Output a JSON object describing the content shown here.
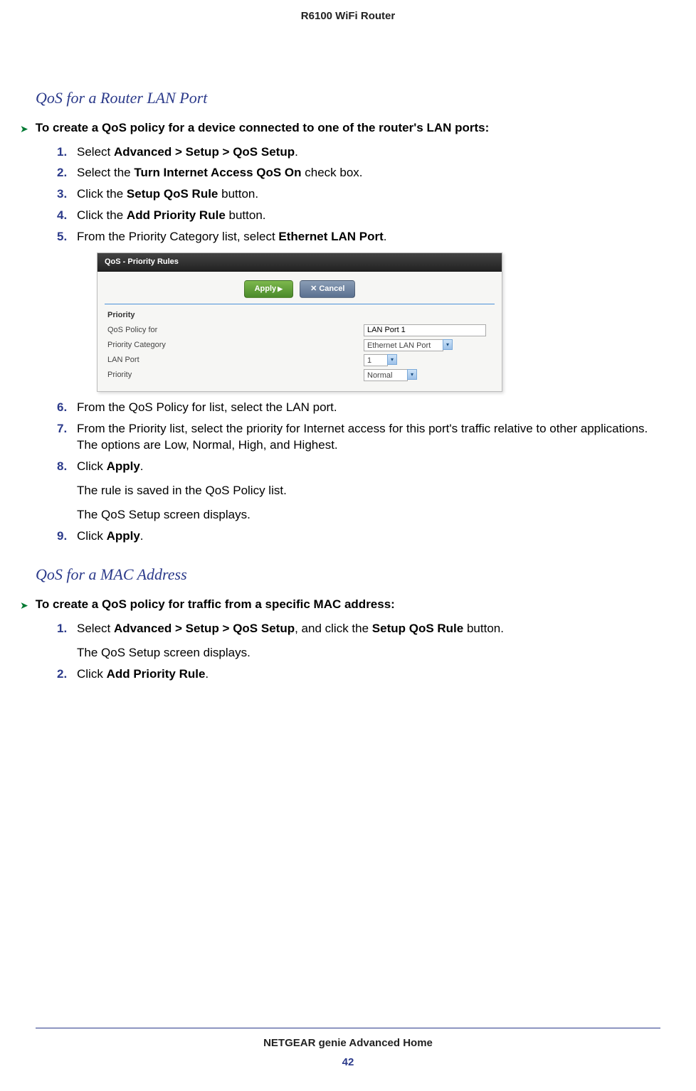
{
  "header": {
    "title": "R6100 WiFi Router"
  },
  "section1": {
    "heading": "QoS for a Router LAN Port",
    "procTitle": "To create a QoS policy for a device connected to one of the router's LAN ports:",
    "steps": {
      "s1": {
        "num": "1.",
        "pre": "Select ",
        "bold": "Advanced > Setup > QoS Setup",
        "post": "."
      },
      "s2": {
        "num": "2.",
        "pre": "Select the ",
        "bold": "Turn Internet Access QoS On",
        "post": " check box."
      },
      "s3": {
        "num": "3.",
        "pre": "Click the ",
        "bold": "Setup QoS Rule",
        "post": " button."
      },
      "s4": {
        "num": "4.",
        "pre": "Click the ",
        "bold": "Add Priority Rule",
        "post": " button."
      },
      "s5": {
        "num": "5.",
        "pre": "From the Priority Category list, select ",
        "bold": "Ethernet LAN Port",
        "post": "."
      },
      "s6": {
        "num": "6.",
        "text": "From the QoS Policy for list, select the LAN port."
      },
      "s7": {
        "num": "7.",
        "text": "From the Priority list, select the priority for Internet access for this port's traffic relative to other applications. The options are Low, Normal, High, and Highest."
      },
      "s8": {
        "num": "8.",
        "pre": "Click ",
        "bold": "Apply",
        "post": ".",
        "sub1": "The rule is saved in the QoS Policy list.",
        "sub2": "The QoS Setup screen displays."
      },
      "s9": {
        "num": "9.",
        "pre": "Click ",
        "bold": "Apply",
        "post": "."
      }
    }
  },
  "ui_mock": {
    "title": "QoS - Priority Rules",
    "applyBtn": "Apply",
    "cancelBtn": "Cancel",
    "sectionTitle": "Priority",
    "rows": {
      "r1": {
        "label": "QoS Policy for",
        "value": "LAN Port 1"
      },
      "r2": {
        "label": "Priority Category",
        "value": "Ethernet LAN Port"
      },
      "r3": {
        "label": "LAN Port",
        "value": "1"
      },
      "r4": {
        "label": "Priority",
        "value": "Normal"
      }
    }
  },
  "section2": {
    "heading": "QoS for a MAC Address",
    "procTitle": "To create a QoS policy for traffic from a specific MAC address:",
    "steps": {
      "s1": {
        "num": "1.",
        "pre": "Select ",
        "bold1": "Advanced > Setup > QoS Setup",
        "mid": ", and click the ",
        "bold2": "Setup QoS Rule",
        "post": " button.",
        "sub1": "The QoS Setup screen displays."
      },
      "s2": {
        "num": "2.",
        "pre": "Click ",
        "bold": "Add Priority Rule",
        "post": "."
      }
    }
  },
  "footer": {
    "title": "NETGEAR genie Advanced Home",
    "page": "42"
  }
}
